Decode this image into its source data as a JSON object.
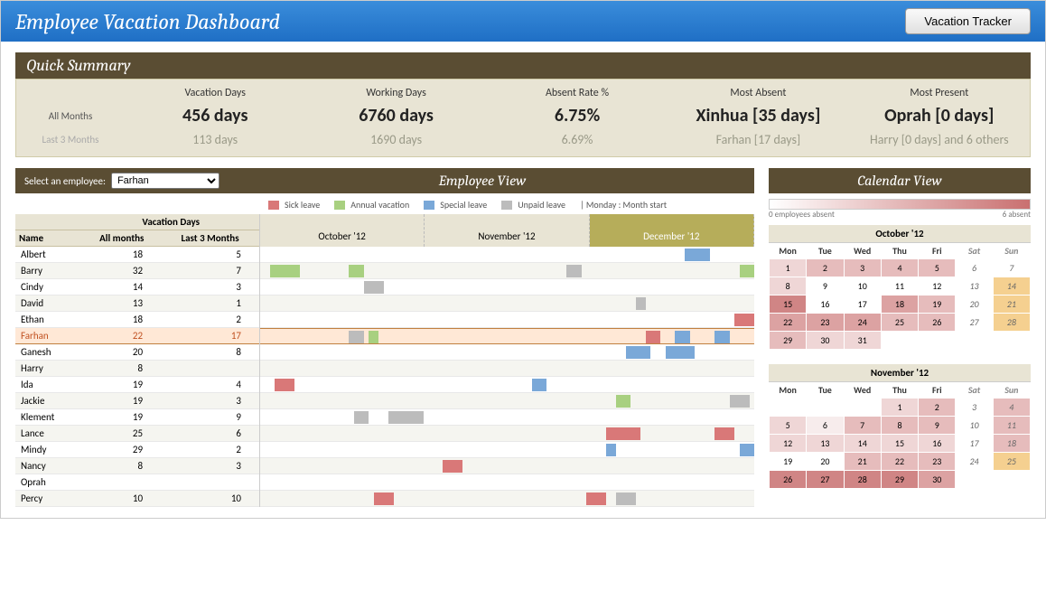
{
  "header": {
    "title": "Employee Vacation Dashboard",
    "tracker_btn": "Vacation Tracker"
  },
  "quick_summary": {
    "title": "Quick Summary",
    "row_all": "All Months",
    "row_last3": "Last 3 Months",
    "cols": {
      "vac_days": "Vacation Days",
      "work_days": "Working Days",
      "absent_rate": "Absent Rate %",
      "most_absent": "Most Absent",
      "most_present": "Most Present"
    },
    "all": {
      "vac_days": "456 days",
      "work_days": "6760 days",
      "absent_rate": "6.75%",
      "most_absent": "Xinhua [35 days]",
      "most_present": "Oprah [0 days]"
    },
    "last3": {
      "vac_days": "113 days",
      "work_days": "1690 days",
      "absent_rate": "6.69%",
      "most_absent": "Farhan [17 days]",
      "most_present": "Harry [0 days] and 6 others"
    }
  },
  "employee_view": {
    "select_label": "Select an employee:",
    "selected": "Farhan",
    "title": "Employee View",
    "legend": {
      "sick": "Sick leave",
      "sick_c": "#d97878",
      "annual": "Annual vacation",
      "annual_c": "#a8d080",
      "special": "Special leave",
      "special_c": "#7aa8d8",
      "unpaid": "Unpaid leave",
      "unpaid_c": "#bcbcbc",
      "monday": "| Monday : Month start"
    },
    "table_hdr": {
      "vac": "Vacation Days",
      "name": "Name",
      "all": "All months",
      "last3": "Last 3 Months"
    },
    "months": [
      "October '12",
      "November '12",
      "December '12"
    ],
    "active_month_index": 2,
    "employees": [
      {
        "name": "Albert",
        "all": 18,
        "last3": 5,
        "bars": [
          {
            "s": 86,
            "w": 5,
            "c": "#7aa8d8"
          }
        ]
      },
      {
        "name": "Barry",
        "all": 32,
        "last3": 7,
        "bars": [
          {
            "s": 2,
            "w": 6,
            "c": "#a8d080"
          },
          {
            "s": 18,
            "w": 3,
            "c": "#a8d080"
          },
          {
            "s": 62,
            "w": 3,
            "c": "#bcbcbc"
          },
          {
            "s": 97,
            "w": 3,
            "c": "#a8d080"
          }
        ]
      },
      {
        "name": "Cindy",
        "all": 14,
        "last3": 3,
        "bars": [
          {
            "s": 21,
            "w": 4,
            "c": "#bcbcbc"
          }
        ]
      },
      {
        "name": "David",
        "all": 13,
        "last3": 1,
        "bars": [
          {
            "s": 76,
            "w": 2,
            "c": "#bcbcbc"
          }
        ]
      },
      {
        "name": "Ethan",
        "all": 18,
        "last3": 2,
        "bars": [
          {
            "s": 96,
            "w": 4,
            "c": "#d97878"
          }
        ]
      },
      {
        "name": "Farhan",
        "all": 22,
        "last3": 17,
        "sel": true,
        "bars": [
          {
            "s": 18,
            "w": 3,
            "c": "#bcbcbc"
          },
          {
            "s": 22,
            "w": 2,
            "c": "#a8d080"
          },
          {
            "s": 78,
            "w": 3,
            "c": "#d97878"
          },
          {
            "s": 84,
            "w": 3,
            "c": "#7aa8d8"
          },
          {
            "s": 92,
            "w": 3,
            "c": "#7aa8d8"
          }
        ]
      },
      {
        "name": "Ganesh",
        "all": 20,
        "last3": 8,
        "bars": [
          {
            "s": 74,
            "w": 5,
            "c": "#7aa8d8"
          },
          {
            "s": 82,
            "w": 6,
            "c": "#7aa8d8"
          }
        ]
      },
      {
        "name": "Harry",
        "all": 8,
        "last3": "",
        "bars": []
      },
      {
        "name": "Ida",
        "all": 19,
        "last3": 4,
        "bars": [
          {
            "s": 3,
            "w": 4,
            "c": "#d97878"
          },
          {
            "s": 55,
            "w": 3,
            "c": "#7aa8d8"
          }
        ]
      },
      {
        "name": "Jackie",
        "all": 19,
        "last3": 3,
        "bars": [
          {
            "s": 72,
            "w": 3,
            "c": "#a8d080"
          },
          {
            "s": 95,
            "w": 4,
            "c": "#bcbcbc"
          }
        ]
      },
      {
        "name": "Klement",
        "all": 19,
        "last3": 9,
        "bars": [
          {
            "s": 19,
            "w": 3,
            "c": "#bcbcbc"
          },
          {
            "s": 26,
            "w": 7,
            "c": "#bcbcbc"
          }
        ]
      },
      {
        "name": "Lance",
        "all": 25,
        "last3": 6,
        "bars": [
          {
            "s": 70,
            "w": 7,
            "c": "#d97878"
          },
          {
            "s": 92,
            "w": 4,
            "c": "#d97878"
          }
        ]
      },
      {
        "name": "Mindy",
        "all": 29,
        "last3": 2,
        "bars": [
          {
            "s": 70,
            "w": 2,
            "c": "#7aa8d8"
          },
          {
            "s": 97,
            "w": 3,
            "c": "#7aa8d8"
          }
        ]
      },
      {
        "name": "Nancy",
        "all": 8,
        "last3": 3,
        "bars": [
          {
            "s": 37,
            "w": 4,
            "c": "#d97878"
          }
        ]
      },
      {
        "name": "Oprah",
        "all": "",
        "last3": "",
        "bars": []
      },
      {
        "name": "Percy",
        "all": 10,
        "last3": 10,
        "bars": [
          {
            "s": 23,
            "w": 4,
            "c": "#d97878"
          },
          {
            "s": 66,
            "w": 4,
            "c": "#d97878"
          },
          {
            "s": 72,
            "w": 4,
            "c": "#bcbcbc"
          }
        ]
      }
    ]
  },
  "calendar_view": {
    "title": "Calendar View",
    "scale_min": "0 employees absent",
    "scale_max": "6 absent",
    "dow": [
      "Mon",
      "Tue",
      "Wed",
      "Thu",
      "Fri",
      "Sat",
      "Sun"
    ],
    "calendars": [
      {
        "title": "October '12",
        "offset": 0,
        "days": 31,
        "heat": [
          2,
          3,
          3,
          3,
          3,
          0,
          0,
          2,
          0,
          0,
          0,
          0,
          0,
          5,
          5,
          0,
          0,
          4,
          3,
          0,
          6,
          4,
          4,
          4,
          3,
          3,
          0,
          6,
          3,
          2,
          2
        ]
      },
      {
        "title": "November '12",
        "offset": 3,
        "days": 30,
        "heat": [
          2,
          3,
          0,
          3,
          2,
          1,
          3,
          3,
          3,
          0,
          3,
          2,
          2,
          2,
          2,
          2,
          0,
          3,
          0,
          0,
          3,
          3,
          3,
          0,
          4,
          5,
          5,
          5,
          5,
          4
        ]
      }
    ]
  }
}
